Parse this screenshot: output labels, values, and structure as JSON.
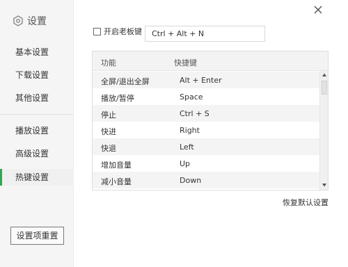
{
  "sidebar": {
    "title": "设置",
    "title_icon": "hexagon-settings-icon",
    "items": [
      {
        "label": "基本设置",
        "active": false
      },
      {
        "label": "下载设置",
        "active": false
      },
      {
        "label": "其他设置",
        "active": false
      },
      {
        "label": "播放设置",
        "active": false
      },
      {
        "label": "高级设置",
        "active": false
      },
      {
        "label": "热键设置",
        "active": true
      }
    ],
    "reset_label": "设置项重置"
  },
  "boss_key": {
    "checked": false,
    "label": "开启老板键",
    "value": "Ctrl + Alt + N"
  },
  "table": {
    "headers": {
      "function": "功能",
      "shortcut": "快捷键"
    },
    "rows": [
      {
        "function": "全屏/退出全屏",
        "shortcut": "Alt + Enter"
      },
      {
        "function": "播放/暂停",
        "shortcut": "Space"
      },
      {
        "function": "停止",
        "shortcut": "Ctrl + S"
      },
      {
        "function": "快进",
        "shortcut": "Right"
      },
      {
        "function": "快退",
        "shortcut": "Left"
      },
      {
        "function": "增加音量",
        "shortcut": "Up"
      },
      {
        "function": "减小音量",
        "shortcut": "Down"
      }
    ]
  },
  "restore_default_label": "恢复默认设置",
  "colors": {
    "active_accent": "#2fa84f",
    "sidebar_bg": "#f5f5f5",
    "alt_row_bg": "#f4f4f4"
  }
}
